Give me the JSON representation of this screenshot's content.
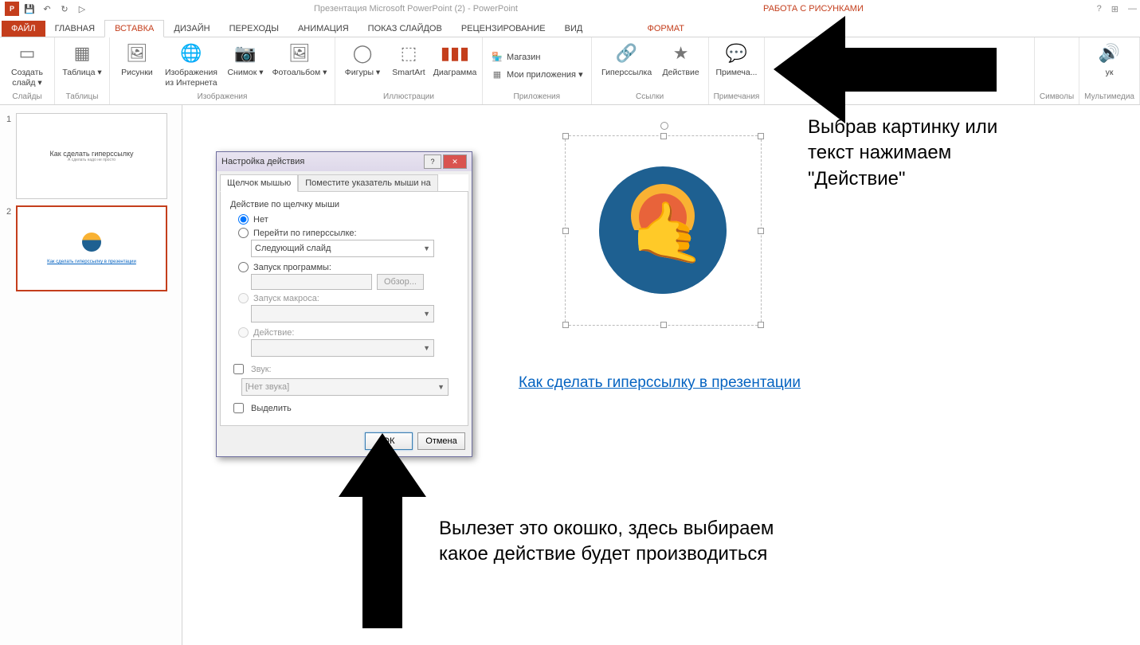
{
  "app": {
    "title": "Презентация Microsoft PowerPoint (2) - PowerPoint",
    "context_tab_title": "РАБОТА С РИСУНКАМИ"
  },
  "qat": {
    "save": "💾",
    "undo": "↶",
    "redo": "↻",
    "start": "▷"
  },
  "win": {
    "help": "?",
    "opts": "⊞",
    "min": "—"
  },
  "tabs": {
    "file": "ФАЙЛ",
    "home": "ГЛАВНАЯ",
    "insert": "ВСТАВКА",
    "design": "ДИЗАЙН",
    "trans": "ПЕРЕХОДЫ",
    "anim": "АНИМАЦИЯ",
    "show": "ПОКАЗ СЛАЙДОВ",
    "review": "РЕЦЕНЗИРОВАНИЕ",
    "view": "ВИД",
    "format": "ФОРМАТ"
  },
  "ribbon": {
    "groups": {
      "slides": {
        "label": "Слайды",
        "new_slide": "Создать слайд ▾"
      },
      "tables": {
        "label": "Таблицы",
        "table": "Таблица ▾"
      },
      "images": {
        "label": "Изображения",
        "pictures": "Рисунки",
        "online": "Изображения из Интернета",
        "screenshot": "Снимок ▾",
        "album": "Фотоальбом ▾"
      },
      "illus": {
        "label": "Иллюстрации",
        "shapes": "Фигуры ▾",
        "smartart": "SmartArt",
        "chart": "Диаграмма"
      },
      "apps": {
        "label": "Приложения",
        "store": "Магазин",
        "myapps": "Мои приложения ▾"
      },
      "links": {
        "label": "Ссылки",
        "hyperlink": "Гиперссылка",
        "action": "Действие"
      },
      "comments": {
        "label": "Примечания",
        "comment": "Примеча..."
      },
      "symbols": {
        "label": "Символы"
      },
      "media": {
        "label": "Мультимедиа",
        "sound": "ук"
      }
    }
  },
  "thumbs": {
    "s1": {
      "num": "1",
      "title": "Как сделать гиперссылку",
      "sub": "А сделать надо не просто"
    },
    "s2": {
      "num": "2",
      "link": "Как сделать гиперссылку в презентации"
    }
  },
  "slide": {
    "link_text": "Как сделать гиперссылку в презентации"
  },
  "dialog": {
    "title": "Настройка действия",
    "help": "?",
    "close": "✕",
    "tab_click": "Щелчок мышью",
    "tab_hover": "Поместите указатель мыши на",
    "group_label": "Действие по щелчку мыши",
    "opt_none": "Нет",
    "opt_hyper": "Перейти по гиперссылке:",
    "hyper_val": "Следующий слайд",
    "opt_run": "Запуск программы:",
    "browse": "Обзор...",
    "opt_macro": "Запуск макроса:",
    "opt_action": "Действие:",
    "chk_sound": "Звук:",
    "sound_val": "[Нет звука]",
    "chk_highlight": "Выделить",
    "ok": "ОК",
    "cancel": "Отмена"
  },
  "annot": {
    "right": "Выбрав картинку или текст нажимаем \"Действие\"",
    "bottom": "Вылезет это окошко, здесь выбираем какое действие будет производиться"
  }
}
